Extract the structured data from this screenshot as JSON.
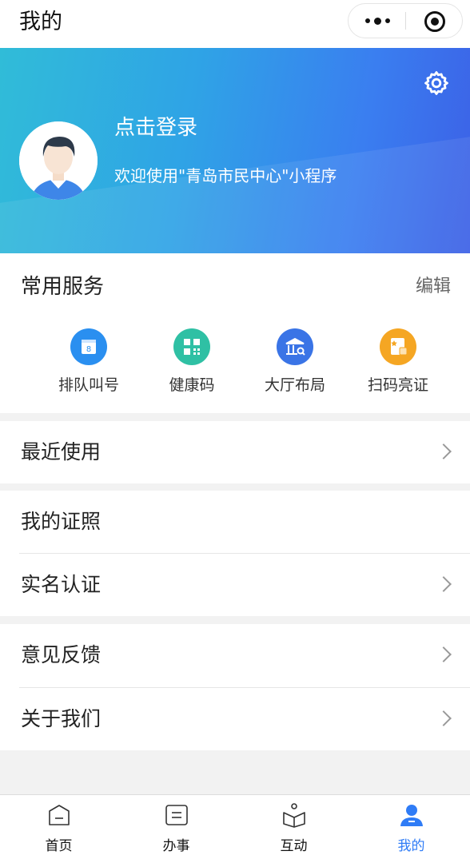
{
  "header": {
    "title": "我的"
  },
  "profile": {
    "login_text": "点击登录",
    "welcome_text": "欢迎使用\"青岛市民中心\"小程序"
  },
  "services": {
    "title": "常用服务",
    "edit_label": "编辑",
    "items": [
      {
        "label": "排队叫号",
        "icon": "queue-number-icon",
        "color": "#2a8ff0"
      },
      {
        "label": "健康码",
        "icon": "qr-health-code-icon",
        "color": "#2fc0a4"
      },
      {
        "label": "大厅布局",
        "icon": "hall-layout-icon",
        "color": "#3a74e6"
      },
      {
        "label": "扫码亮证",
        "icon": "scan-license-icon",
        "color": "#f5a623"
      }
    ]
  },
  "menu": {
    "recent": "最近使用",
    "certificates": "我的证照",
    "realname": "实名认证",
    "feedback": "意见反馈",
    "about": "关于我们"
  },
  "tabs": [
    {
      "label": "首页",
      "icon": "home-icon"
    },
    {
      "label": "办事",
      "icon": "affairs-icon"
    },
    {
      "label": "互动",
      "icon": "interact-icon"
    },
    {
      "label": "我的",
      "icon": "user-icon",
      "active": true
    }
  ],
  "colors": {
    "accent": "#2f7cf6",
    "hero_start": "#30bcd8",
    "hero_end": "#3c60e6"
  }
}
